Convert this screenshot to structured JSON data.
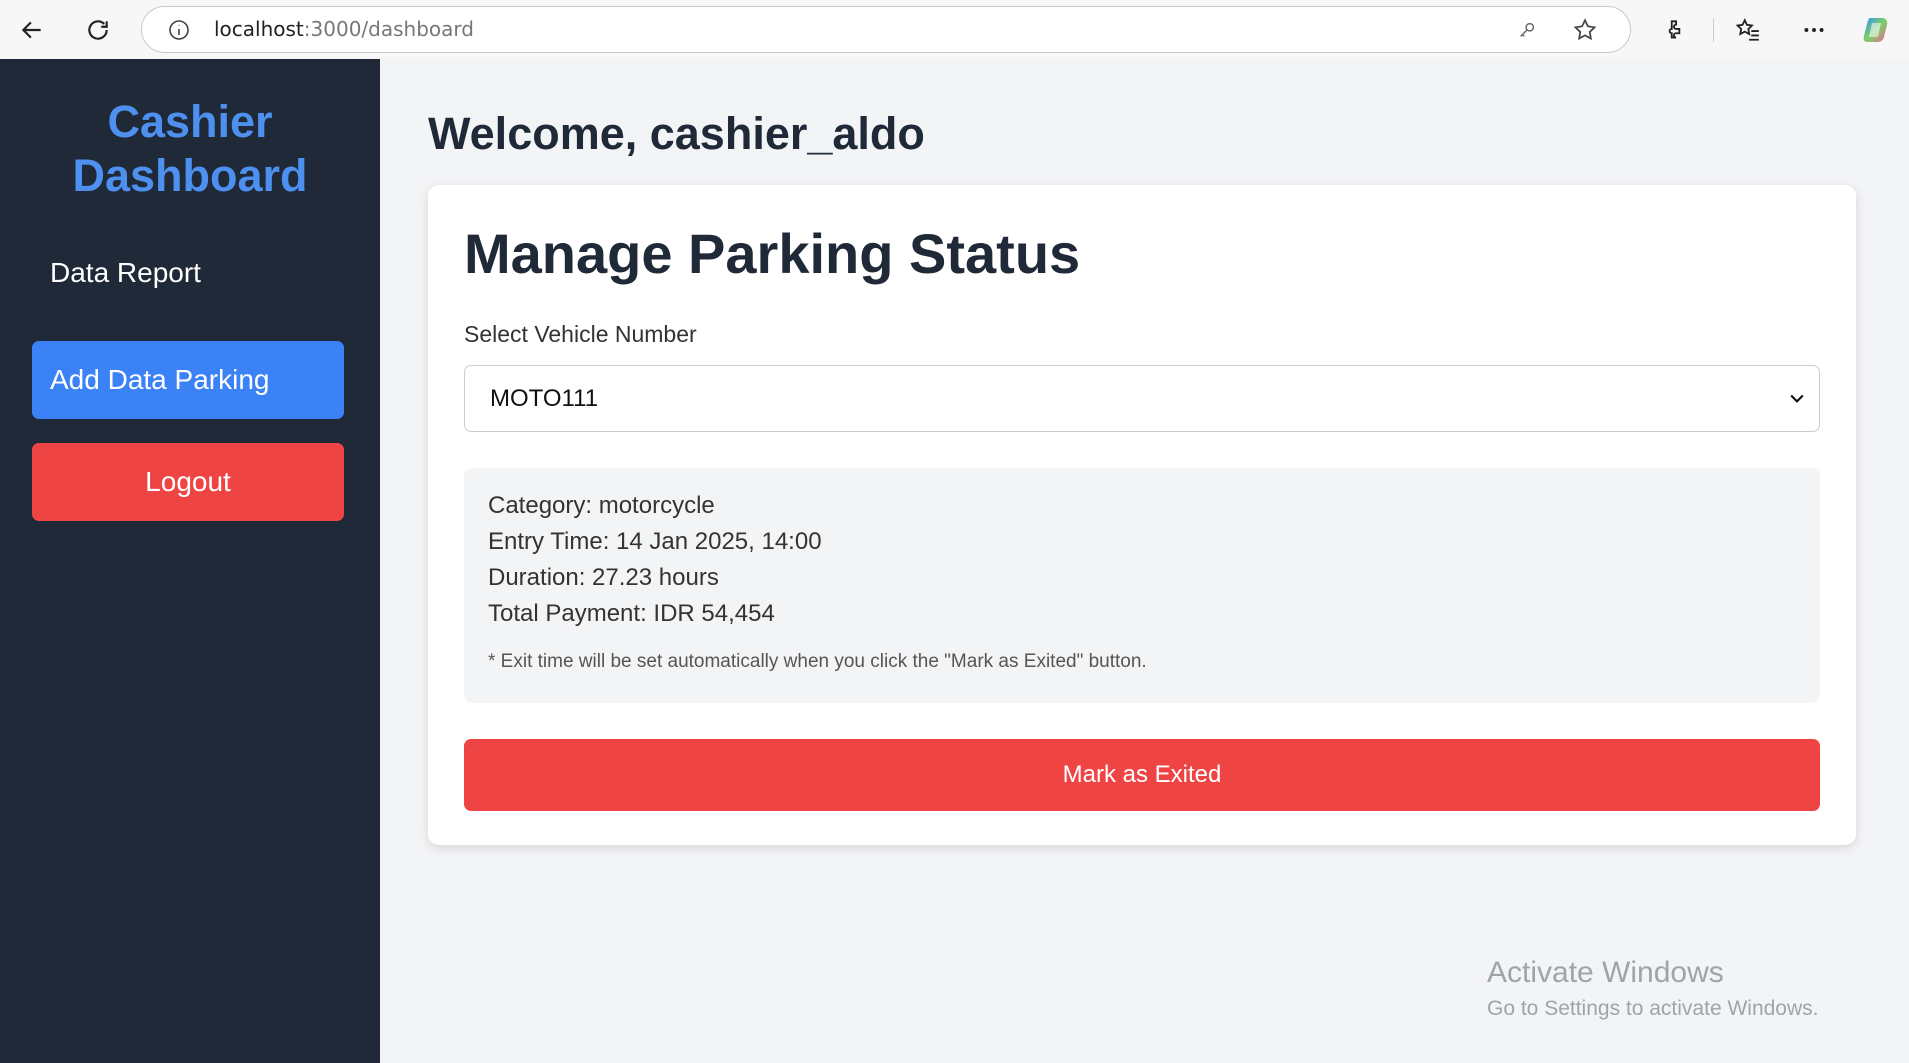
{
  "browser": {
    "url_host": "localhost",
    "url_path": ":3000/dashboard"
  },
  "sidebar": {
    "title": "Cashier Dashboard",
    "data_report": "Data Report",
    "add_data_parking": "Add Data Parking",
    "logout": "Logout"
  },
  "main": {
    "welcome": "Welcome, cashier_aldo",
    "card_title": "Manage Parking Status",
    "select_label": "Select Vehicle Number",
    "selected_vehicle": "MOTO111",
    "info": {
      "category": "Category: motorcycle",
      "entry_time": "Entry Time: 14 Jan 2025, 14:00",
      "duration": "Duration: 27.23 hours",
      "total_payment": "Total Payment: IDR 54,454",
      "note": "* Exit time will be set automatically when you click the \"Mark as Exited\" button."
    },
    "exit_button": "Mark as Exited"
  },
  "watermark": {
    "title": "Activate Windows",
    "subtitle": "Go to Settings to activate Windows."
  },
  "colors": {
    "sidebar_bg": "#1f2937",
    "title_blue": "#4d90f0",
    "primary_blue": "#3b82f6",
    "danger_red": "#ef4444",
    "page_bg": "#f3f4f6"
  },
  "icons": [
    "back-arrow-icon",
    "reload-icon",
    "info-icon",
    "key-icon",
    "star-icon",
    "extensions-icon",
    "favorites-icon",
    "more-icon",
    "copilot-icon",
    "chevron-down-icon"
  ]
}
